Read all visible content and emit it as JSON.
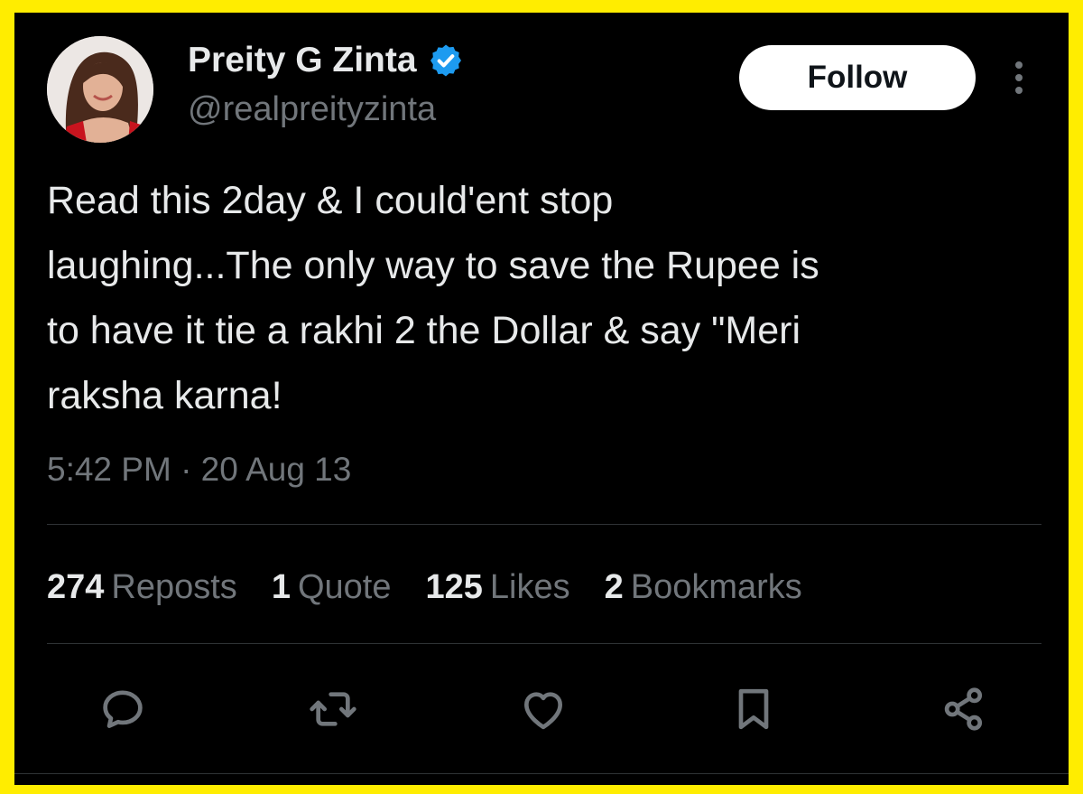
{
  "user": {
    "display_name": "Preity G Zinta",
    "handle": "@realpreityzinta",
    "verified": true
  },
  "follow_label": "Follow",
  "tweet": {
    "text": "Read this 2day & I could'ent stop\nlaughing...The only way to save the Rupee is\nto have it tie a rakhi 2 the Dollar & say \"Meri\nraksha karna!",
    "timestamp": "5:42 PM · 20 Aug 13"
  },
  "stats": [
    {
      "count": "274",
      "label": "Reposts"
    },
    {
      "count": "1",
      "label": "Quote"
    },
    {
      "count": "125",
      "label": "Likes"
    },
    {
      "count": "2",
      "label": "Bookmarks"
    }
  ],
  "actions": [
    {
      "icon": "reply-icon"
    },
    {
      "icon": "repost-icon"
    },
    {
      "icon": "like-icon"
    },
    {
      "icon": "bookmark-icon"
    },
    {
      "icon": "share-icon"
    }
  ],
  "colors": {
    "frame": "#FFED00",
    "background": "#000000",
    "text": "#E7E9EA",
    "muted": "#71767B",
    "verified": "#1D9BF0",
    "divider": "#2F3336"
  }
}
